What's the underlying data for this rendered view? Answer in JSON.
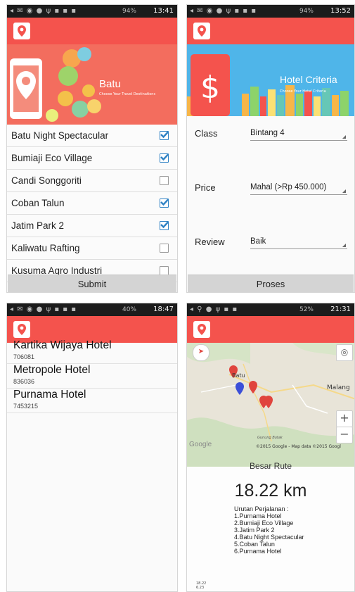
{
  "status_bars": [
    {
      "time": "13:41",
      "battery": "94%"
    },
    {
      "time": "13:52",
      "battery": "94%"
    },
    {
      "time": "18:47",
      "battery": "40%"
    },
    {
      "time": "21:31",
      "battery": "52%"
    }
  ],
  "colors": {
    "appbar": "#f4534d",
    "banner_red": "#f36d5e",
    "banner_blue": "#4fb5e9",
    "check_blue": "#2f82c4"
  },
  "destinations": {
    "banner_title": "Batu",
    "banner_subtitle": "Choose Your Travel Destinations",
    "items": [
      {
        "label": "Batu Night Spectacular",
        "checked": true
      },
      {
        "label": "Bumiaji Eco Village",
        "checked": true
      },
      {
        "label": "Candi Songgoriti",
        "checked": false
      },
      {
        "label": "Coban Talun",
        "checked": true
      },
      {
        "label": "Jatim Park 2",
        "checked": true
      },
      {
        "label": "Kaliwatu Rafting",
        "checked": false
      },
      {
        "label": "Kusuma Agro Industri",
        "checked": false
      }
    ],
    "submit_label": "Submit"
  },
  "criteria": {
    "banner_title": "Hotel Criteria",
    "banner_subtitle": "Choose Your Hotel Criteria",
    "banner_icon": "dollar-sign-icon",
    "fields": [
      {
        "label": "Class",
        "value": "Bintang 4"
      },
      {
        "label": "Price",
        "value": "Mahal (>Rp 450.000)"
      },
      {
        "label": "Review",
        "value": "Baik"
      }
    ],
    "submit_label": "Proses"
  },
  "hotels": [
    {
      "name": "Kartika Wijaya Hotel",
      "phone": "706081"
    },
    {
      "name": "Metropole Hotel",
      "phone": "836036"
    },
    {
      "name": "Purnama Hotel",
      "phone": "7453215"
    }
  ],
  "route": {
    "map": {
      "labels": [
        "Batu",
        "Malang",
        "Gunung Butak"
      ],
      "watermark": "Google",
      "copyright": "©2015 Google - Map data ©2015 Googl"
    },
    "title": "Besar Rute",
    "distance": "18.22 km",
    "order_heading": "Urutan Perjalanan :",
    "order": [
      "1.Purnama Hotel",
      "2.Bumiaji Eco Village",
      "3.Jatim Park 2",
      "4.Batu Night Spectacular",
      "5.Coban Talun",
      "6.Purnama Hotel"
    ],
    "footer_lines": [
      "18.22",
      "6.23"
    ]
  }
}
